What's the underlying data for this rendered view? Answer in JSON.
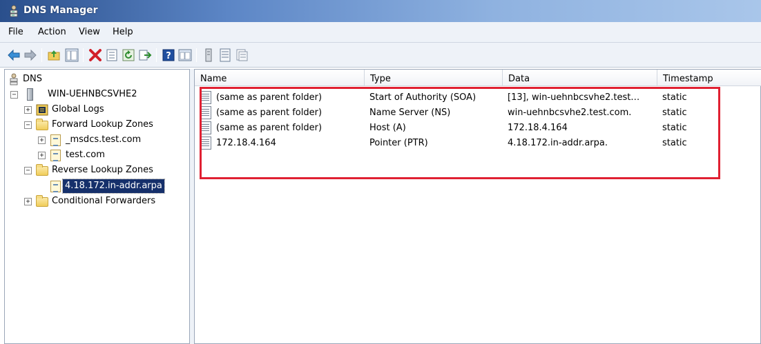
{
  "window": {
    "title": "DNS Manager",
    "icon": "dns-app-icon"
  },
  "menu": [
    "File",
    "Action",
    "View",
    "Help"
  ],
  "toolbar": {
    "buttons": [
      "back-arrow-icon",
      "forward-arrow-icon",
      "up-folder-icon",
      "show-hide-tree-icon",
      "delete-icon",
      "properties-icon",
      "refresh-icon",
      "export-list-icon",
      "help-icon",
      "console-tree-icon",
      "server-icon",
      "zone-list-icon",
      "zone-properties-icon"
    ]
  },
  "tree": {
    "root": "DNS",
    "server": "WIN-UEHNBCSVHE2",
    "global_logs": "Global Logs",
    "forward_zones": "Forward Lookup Zones",
    "msdcs": "_msdcs.test.com",
    "test_com": "test.com",
    "reverse_zones": "Reverse Lookup Zones",
    "selected_zone": "4.18.172.in-addr.arpa",
    "conditional_forwarders": "Conditional Forwarders"
  },
  "columns": {
    "name": "Name",
    "type": "Type",
    "data": "Data",
    "timestamp": "Timestamp"
  },
  "records": [
    {
      "name": "(same as parent folder)",
      "type": "Start of Authority (SOA)",
      "data": "[13], win-uehnbcsvhe2.test…",
      "timestamp": "static"
    },
    {
      "name": "(same as parent folder)",
      "type": "Name Server (NS)",
      "data": "win-uehnbcsvhe2.test.com.",
      "timestamp": "static"
    },
    {
      "name": "(same as parent folder)",
      "type": "Host (A)",
      "data": "172.18.4.164",
      "timestamp": "static"
    },
    {
      "name": "172.18.4.164",
      "type": "Pointer (PTR)",
      "data": "4.18.172.in-addr.arpa.",
      "timestamp": "static"
    }
  ],
  "colors": {
    "highlight": "#e02032",
    "selection": "#16306b"
  }
}
